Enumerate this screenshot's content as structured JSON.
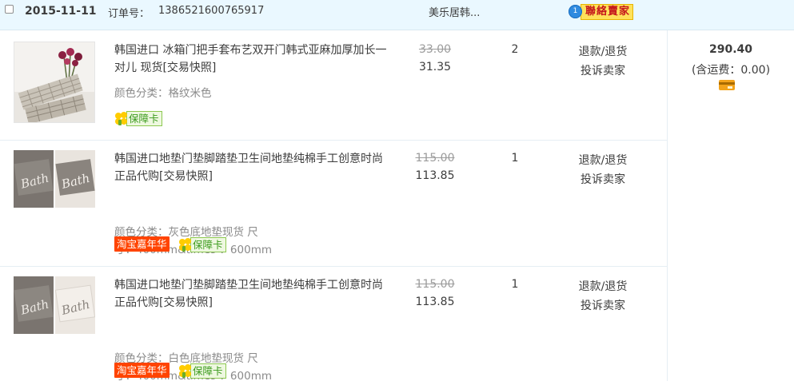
{
  "order": {
    "date": "2015-11-11",
    "order_no_label": "订单号：",
    "order_no": "1386521600765917",
    "shop_name": "美乐居韩...",
    "contact_seller": "聯絡賣家",
    "contact_bubble": "1"
  },
  "items": [
    {
      "title": "韩国进口 冰箱门把手套布艺双开门韩式亚麻加厚加长一对儿 现货[交易快照]",
      "sku_line1": "颜色分类：格纹米色",
      "sku_line2": "",
      "price_original": "33.00",
      "price_now": "31.35",
      "quantity": "2",
      "action_refund": "退款/退货",
      "action_complain": "投诉卖家",
      "badges": [
        "保障卡"
      ]
    },
    {
      "title": "韩国进口地垫门垫脚踏垫卫生间地垫纯棉手工创意时尚正品代购[交易快照]",
      "sku_line1": "颜色分类：灰色底地垫现货  尺",
      "sku_line2": "寸：400mm&times  ：600mm",
      "price_original": "115.00",
      "price_now": "113.85",
      "quantity": "1",
      "action_refund": "退款/退货",
      "action_complain": "投诉卖家",
      "badges": [
        "淘宝嘉年华",
        "保障卡"
      ]
    },
    {
      "title": "韩国进口地垫门垫脚踏垫卫生间地垫纯棉手工创意时尚正品代购[交易快照]",
      "sku_line1": "颜色分类：白色底地垫现货  尺",
      "sku_line2": "寸：400mm&times  ：600mm",
      "price_original": "115.00",
      "price_now": "113.85",
      "quantity": "1",
      "action_refund": "退款/退货",
      "action_complain": "投诉卖家",
      "badges": [
        "淘宝嘉年华",
        "保障卡"
      ]
    }
  ],
  "total": {
    "amount": "290.40",
    "shipping": "(含运费：0.00)"
  },
  "colors": {
    "header_bg": "#eaf8ff",
    "carnival_badge": "#ff4400",
    "guarantee_badge": "#3a9a1b",
    "payment_icon": "#f3a31a"
  },
  "icons": [
    "checkbox",
    "contact-bubble-icon",
    "guarantee-flower-icon",
    "payment-card-icon"
  ]
}
